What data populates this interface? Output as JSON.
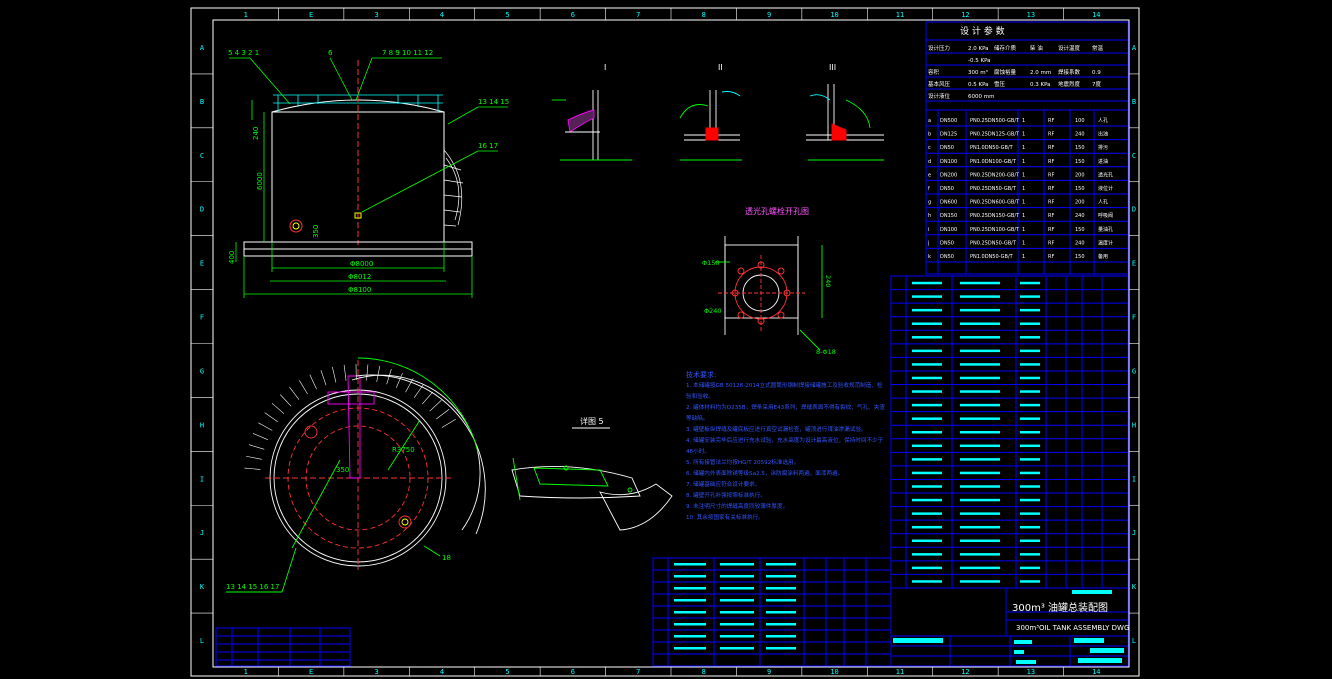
{
  "frame": {
    "col_labels": [
      "1",
      "E",
      "3",
      "4",
      "5",
      "6",
      "7",
      "8",
      "9",
      "10",
      "11",
      "12",
      "13",
      "14"
    ],
    "row_labels": [
      "A",
      "B",
      "C",
      "D",
      "E",
      "F",
      "G",
      "H",
      "I",
      "J",
      "K",
      "L"
    ]
  },
  "colors": {
    "frame": "#ffffff",
    "object": "#ffffff",
    "dimension": "#00ff00",
    "centerline": "#ff3333",
    "text": "#3333ff",
    "table": "#0000ff",
    "highlight": "#ff00ff",
    "cyan": "#00ffff",
    "yellow": "#ffff00"
  },
  "elevation_view": {
    "callouts_left": "5 4 3 2 1",
    "callout_mid": "6",
    "callouts_right": "7 8 9 10 11 12",
    "callouts_side": "13 14 15",
    "callout_pipe": "16 17",
    "dims": {
      "roof_height": "240",
      "shell_height": "6000",
      "shell_dia": "Φ8000",
      "shell_outer": "Φ8012",
      "base_dia": "Φ8100",
      "base_h": "400",
      "nozzle_h": "350"
    }
  },
  "details": {
    "d1": "I",
    "d2": "II",
    "d3": "III",
    "flange_title": "透光孔螺栓开孔图",
    "flange_dims": {
      "left": "Φ150",
      "right": "240",
      "bottom": "Φ240",
      "bolt": "8-Φ18"
    }
  },
  "detail5": {
    "title": "详图 5"
  },
  "plan_view": {
    "dims": {
      "a": "350",
      "b": "R3750"
    },
    "callouts_bottom": "13 14 15 16 17",
    "callout_right": "18"
  },
  "notes": {
    "heading": "技术要求:",
    "lines": [
      "1. 本储罐按GB 50128-2014立式圆筒形钢制焊接储罐施工及验收规范制造、检验和验收。",
      "2. 罐体材料均为Q235B，焊条采用E43系列，焊缝表面不得有裂纹、气孔、夹渣等缺陷。",
      "3. 罐壁板纵焊缝及罐底板应进行真空试漏检查，罐顶进行煤油渗漏试验。",
      "4. 储罐安装完毕后应进行充水试验，充水高度为设计最高液位，保持时间不少于48小时。",
      "5. 所有接管法兰均按HG/T 20592标准选用。",
      "6. 储罐内外表面除锈等级Sa2.5，涂防腐涂料两遍，面漆两遍。",
      "7. 储罐基础应符合设计要求。",
      "8. 罐壁开孔补强按照标准执行。",
      "9. 未注明尺寸的焊缝高度同较薄件厚度。",
      "10. 其余按国家有关标准执行。"
    ]
  },
  "spec_table": {
    "title": "设 计 参 数",
    "rows": [
      [
        "设计压力",
        "2.0 KPa",
        "储存介质",
        "柴 油",
        "设计温度",
        "常温"
      ],
      [
        "",
        "-0.5 KPa",
        "",
        "",
        "",
        ""
      ],
      [
        "容积",
        "300 m³",
        "腐蚀裕量",
        "2.0 mm",
        "焊接系数",
        "0.9"
      ],
      [
        "基本风压",
        "0.5 KPa",
        "雪压",
        "0.3 KPa",
        "地震烈度",
        "7度"
      ],
      [
        "设计液位",
        "6000 mm",
        "",
        "",
        "",
        ""
      ]
    ]
  },
  "nozzle_table": {
    "rows": [
      [
        "a",
        "DN500",
        "PN0.25DN500-GB/T",
        "1",
        "RF",
        "100",
        "人孔"
      ],
      [
        "b",
        "DN125",
        "PN0.25DN125-GB/T",
        "1",
        "RF",
        "240",
        "出油"
      ],
      [
        "c",
        "DN50",
        "PN1.0DN50-GB/T",
        "1",
        "RF",
        "150",
        "排污"
      ],
      [
        "d",
        "DN100",
        "PN1.0DN100-GB/T",
        "1",
        "RF",
        "150",
        "进油"
      ],
      [
        "e",
        "DN200",
        "PN0.25DN200-GB/T",
        "1",
        "RF",
        "200",
        "透光孔"
      ],
      [
        "f",
        "DN50",
        "PN0.25DN50-GB/T",
        "1",
        "RF",
        "150",
        "液位计"
      ],
      [
        "g",
        "DN600",
        "PN0.25DN600-GB/T",
        "1",
        "RF",
        "200",
        "人孔"
      ],
      [
        "h",
        "DN150",
        "PN0.25DN150-GB/T",
        "1",
        "RF",
        "240",
        "呼吸阀"
      ],
      [
        "i",
        "DN100",
        "PN0.25DN100-GB/T",
        "1",
        "RF",
        "150",
        "量油孔"
      ],
      [
        "j",
        "DN50",
        "PN0.25DN50-GB/T",
        "1",
        "RF",
        "240",
        "温度计"
      ],
      [
        "k",
        "DN50",
        "PN1.0DN50-GB/T",
        "1",
        "RF",
        "150",
        "备用"
      ]
    ]
  },
  "bom_rows": 23,
  "bottom_bom_rows": 9,
  "title_block": {
    "title_cn": "300m³ 油罐总装配图",
    "title_en": "300m³OIL TANK ASSEMBLY DWG"
  }
}
